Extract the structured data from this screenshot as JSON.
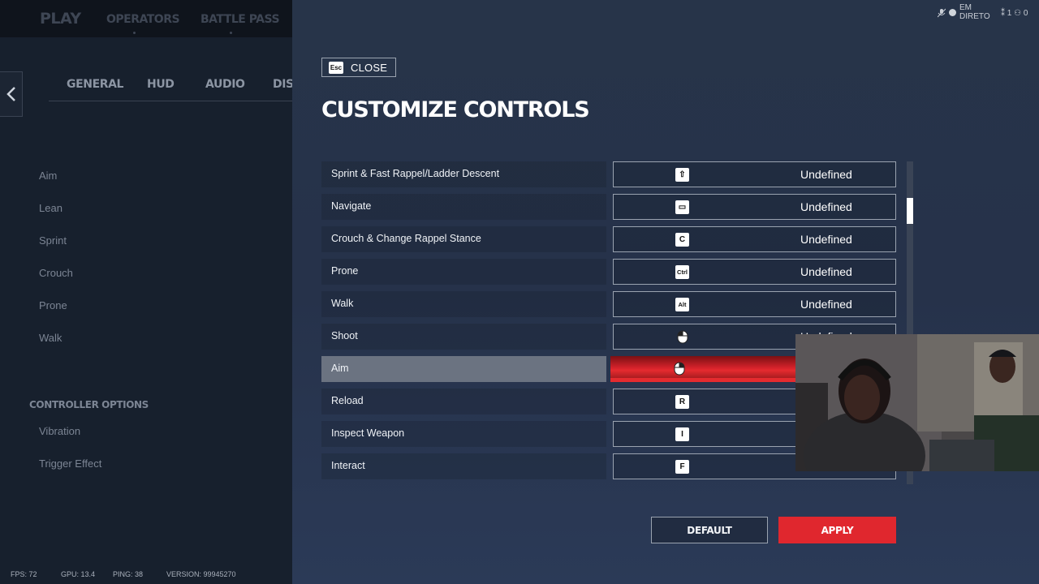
{
  "topnav": {
    "play": "PLAY",
    "operators": "OPERATORS",
    "battle_pass": "BATTLE PASS"
  },
  "settings_tabs": [
    "GENERAL",
    "HUD",
    "AUDIO",
    "DISPLAY"
  ],
  "left_list": [
    "Aim",
    "Lean",
    "Sprint",
    "Crouch",
    "Prone",
    "Walk"
  ],
  "controller_options": {
    "title": "CONTROLLER OPTIONS",
    "items": [
      "Vibration",
      "Trigger Effect"
    ]
  },
  "close": {
    "key": "Esc",
    "label": "CLOSE"
  },
  "page_title": "CUSTOMIZE CONTROLS",
  "controls": [
    {
      "label": "Sprint & Fast Rappel/Ladder Descent",
      "key": "⇧",
      "icon": "shift-key-icon",
      "value": "Undefined"
    },
    {
      "label": "Navigate",
      "key": "▭",
      "icon": "spacebar-key-icon",
      "value": "Undefined"
    },
    {
      "label": "Crouch & Change Rappel Stance",
      "key": "C",
      "icon": "c-key-icon",
      "value": "Undefined"
    },
    {
      "label": "Prone",
      "key": "Ctrl",
      "icon": "ctrl-key-icon",
      "value": "Undefined"
    },
    {
      "label": "Walk",
      "key": "Alt",
      "icon": "alt-key-icon",
      "value": "Undefined"
    },
    {
      "label": "Shoot",
      "key": "",
      "icon": "mouse-left-click-icon",
      "value": "Undefined"
    },
    {
      "label": "Aim",
      "key": "",
      "icon": "mouse-right-click-icon",
      "value": ""
    },
    {
      "label": "Reload",
      "key": "R",
      "icon": "r-key-icon",
      "value": ""
    },
    {
      "label": "Inspect Weapon",
      "key": "I",
      "icon": "i-key-icon",
      "value": ""
    },
    {
      "label": "Interact",
      "key": "F",
      "icon": "f-key-icon",
      "value": ""
    }
  ],
  "selected_control": "Aim",
  "buttons": {
    "default": "DEFAULT",
    "apply": "APPLY"
  },
  "footer": {
    "fps": "FPS: 72",
    "gpu": "GPU: 13.4",
    "ping": "PING: 38",
    "version": "VERSION: 99945270"
  },
  "stream": {
    "status_line1": "EM",
    "status_line2": "DIRETO",
    "viewers": "1",
    "followers": "0"
  },
  "colors": {
    "accent_red": "#e0272e",
    "panel_bg": "#17202d",
    "main_bg": "#273449"
  }
}
